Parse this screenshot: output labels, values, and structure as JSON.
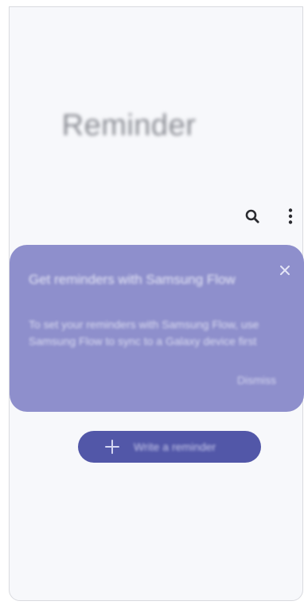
{
  "app": {
    "title": "Reminder"
  },
  "toolbar": {
    "search_icon": "search-icon",
    "more_icon": "more-options-icon"
  },
  "card": {
    "heading": "Get reminders with Samsung Flow",
    "body": "To set your reminders with Samsung Flow, use Samsung Flow to sync to a Galaxy device first",
    "action_label": "Dismiss",
    "close_icon": "close-icon",
    "background_color": "#8e8fcc"
  },
  "add_button": {
    "label": "Write a reminder",
    "icon": "plus-icon",
    "background_color": "#5257a8"
  }
}
